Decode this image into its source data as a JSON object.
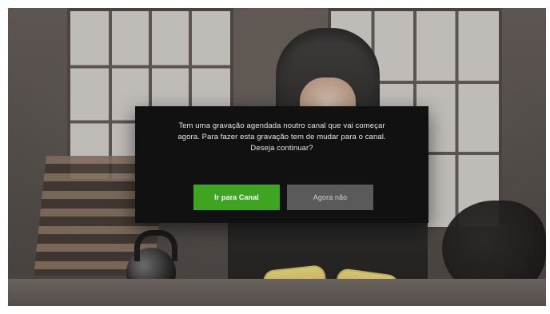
{
  "dialog": {
    "message_lines": [
      "Tem uma gravação agendada noutro canal que vai começar",
      "agora. Para fazer esta gravação tem de mudar para o canal.",
      "Deseja continuar?"
    ],
    "primary_action_label": "Ir para Canal",
    "secondary_action_label": "Agora não"
  },
  "colors": {
    "primary_button": "#3ea421",
    "secondary_button": "#5a5a5a",
    "dialog_background": "#111111",
    "dialog_text": "#e6e6e6"
  }
}
